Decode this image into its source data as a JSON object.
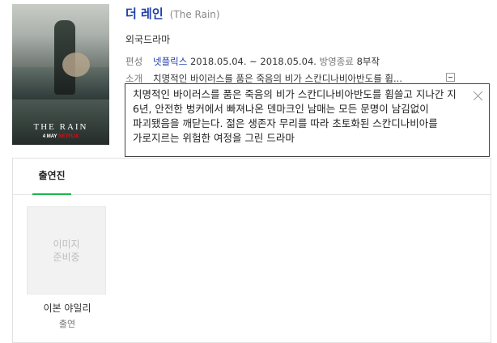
{
  "drama": {
    "title": "더 레인",
    "title_en": "(The Rain)",
    "genre": "외국드라마",
    "edit_label": "편성",
    "network": "넷플릭스",
    "dates": "2018.05.04. ~ 2018.05.04.",
    "status": "방영종료",
    "episodes": "8부작",
    "desc_label": "소개",
    "desc_short": "치명적인 바이러스를 품은 죽음의 비가 스칸디나비아반도를 휩...",
    "desc_full": "치명적인 바이러스를 품은 죽음의 비가 스칸디나비아반도를 휩쓸고 지나간 지 6년, 안전한 벙커에서 빠져나온 덴마크인 남매는 모든 문명이 남김없이 파괴됐음을 깨닫는다. 젊은 생존자 무리를 따라 초토화된 스칸디나비아를 가로지르는 위험한 여정을 그린 드라마"
  },
  "poster": {
    "logo_text": "THE RAIN",
    "date_text": "4 MAY",
    "brand_text": "NETFLIX"
  },
  "cast": {
    "tab_label": "출연진",
    "members": [
      {
        "image_placeholder": "이미지 준비중",
        "name": "이본 야일리",
        "role": "출연"
      }
    ]
  },
  "colors": {
    "title_blue": "#1e3fad",
    "tab_green": "#19b84d",
    "netflix_red": "#e50914"
  }
}
